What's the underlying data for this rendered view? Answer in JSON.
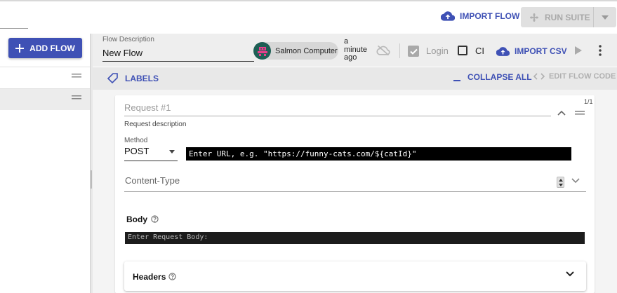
{
  "toolbar": {
    "import_flow_label": "IMPORT FLOW",
    "run_suite_label": "RUN SUITE"
  },
  "sidebar": {
    "add_flow_label": "ADD FLOW"
  },
  "flow": {
    "description_label": "Flow Description",
    "description_value": "New Flow",
    "user_name": "Salmon Computer",
    "saved_time": "a minute ago",
    "login_label": "Login",
    "login_checked": true,
    "ci_label": "CI",
    "ci_checked": false,
    "import_csv_label": "IMPORT CSV"
  },
  "labels_bar": {
    "labels_label": "LABELS",
    "collapse_all_label": "COLLAPSE ALL",
    "edit_flow_code_label": "EDIT FLOW CODE"
  },
  "request": {
    "count": "1/1",
    "title_placeholder": "Request #1",
    "description_placeholder": "Request description",
    "method_label": "Method",
    "method_value": "POST",
    "url_placeholder": "Enter URL, e.g. \"https://funny-cats.com/${catId}\"",
    "content_type_placeholder": "Content-Type",
    "body_label": "Body",
    "body_placeholder": "Enter Request Body:",
    "headers_label": "Headers"
  },
  "colors": {
    "accent": "#3f51b5",
    "avatar_bg": "#1e5f55",
    "avatar_fg": "#e83e8c",
    "code_bg": "#000000"
  },
  "icons": [
    "cloud-upload-icon",
    "fan-icon",
    "caret-down-icon",
    "plus-icon",
    "drag-handle-icon",
    "cloud-off-icon",
    "check-icon",
    "play-icon",
    "more-vert-icon",
    "label-icon",
    "code-icon",
    "chevron-up-icon",
    "chevron-down-icon",
    "help-icon"
  ]
}
